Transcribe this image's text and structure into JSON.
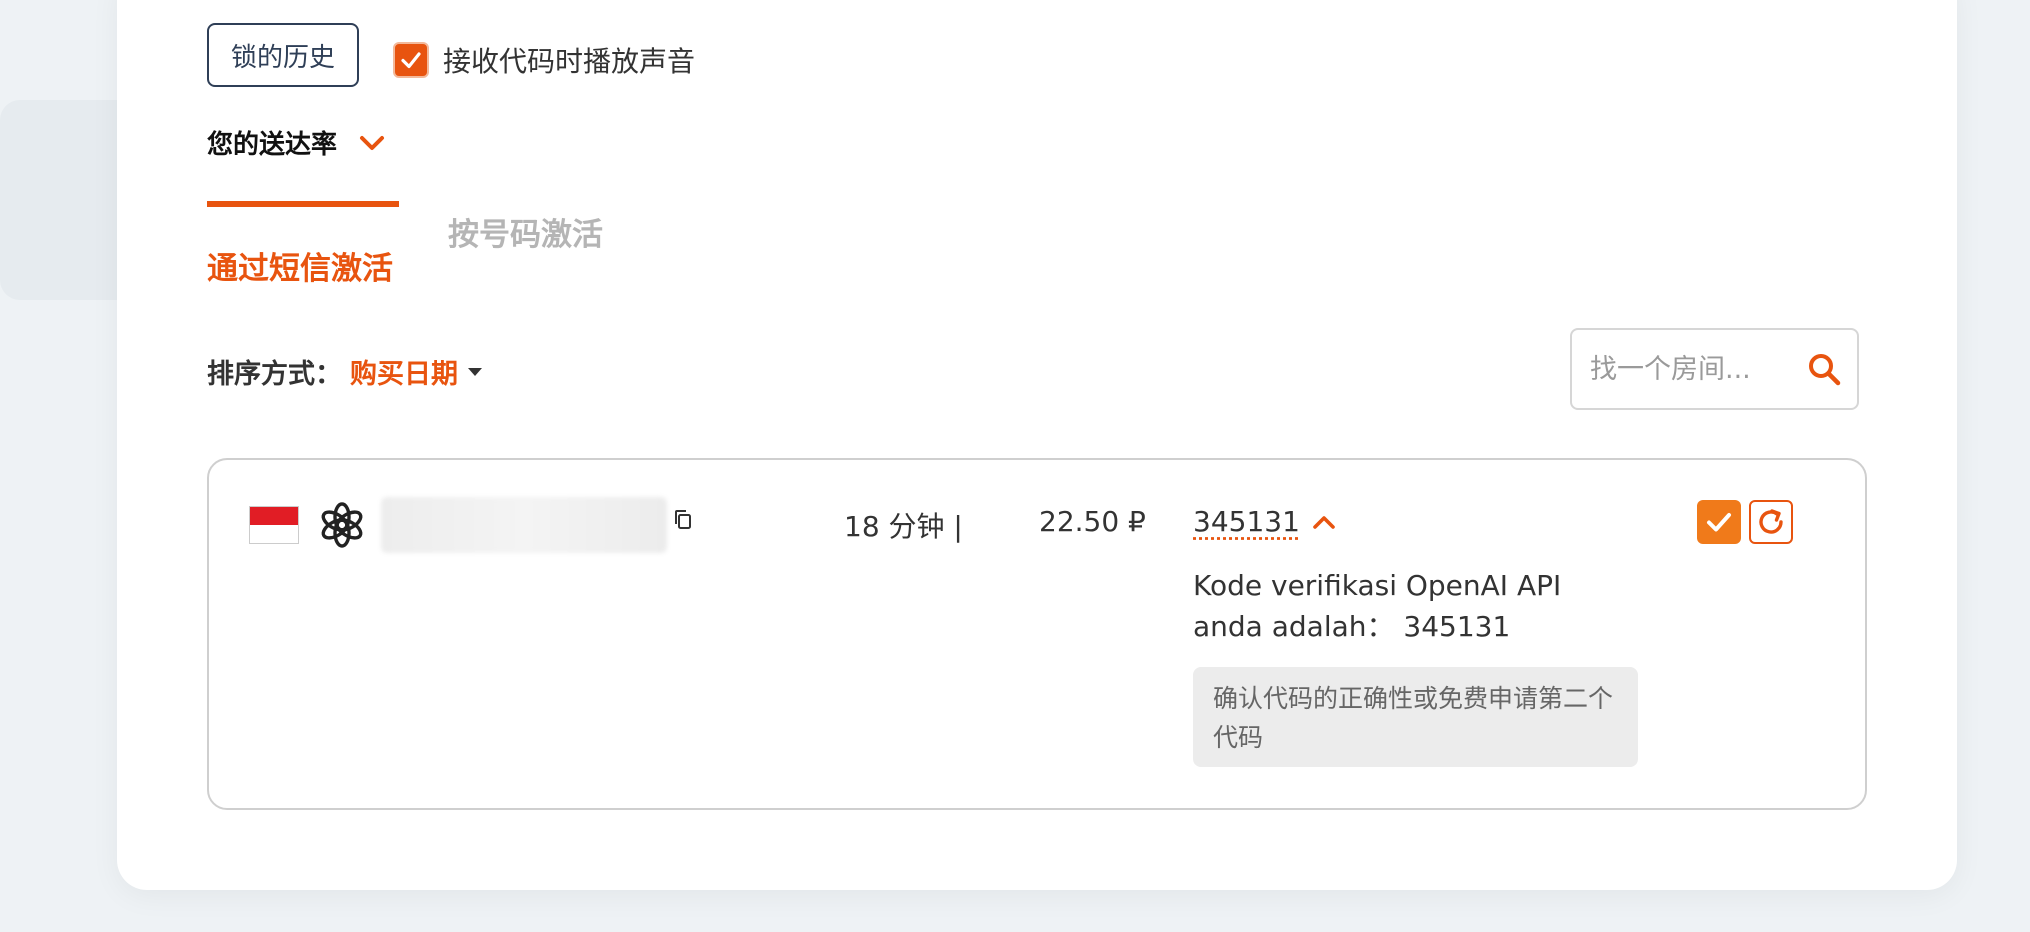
{
  "colors": {
    "accent": "#e8540f",
    "accent_light": "#f07a1a",
    "border": "#cfcfcf"
  },
  "header": {
    "history_button": "锁的历史",
    "sound_checkbox": {
      "label": "接收代码时播放声音",
      "checked": true
    },
    "delivery_rate_label": "您的送达率",
    "delivery_rate_icon": "chevron-down-icon"
  },
  "tabs": [
    {
      "label": "通过短信激活",
      "active": true
    },
    {
      "label": "按号码激活",
      "active": false
    }
  ],
  "sort": {
    "label": "排序方式：",
    "value": "购买日期"
  },
  "search": {
    "placeholder": "找一个房间...",
    "value": "",
    "icon": "search-icon"
  },
  "orders": [
    {
      "country_flag": "indonesia-flag-icon",
      "service_icon": "openai-icon",
      "phone": "",
      "duration": "18 分钟 |",
      "price": "22.50 ₽",
      "code": "345131",
      "message": "Kode verifikasi OpenAI API anda adalah：  345131",
      "notice": "确认代码的正确性或免费申请第二个代码",
      "actions": [
        "confirm-icon",
        "refresh-icon"
      ]
    }
  ]
}
